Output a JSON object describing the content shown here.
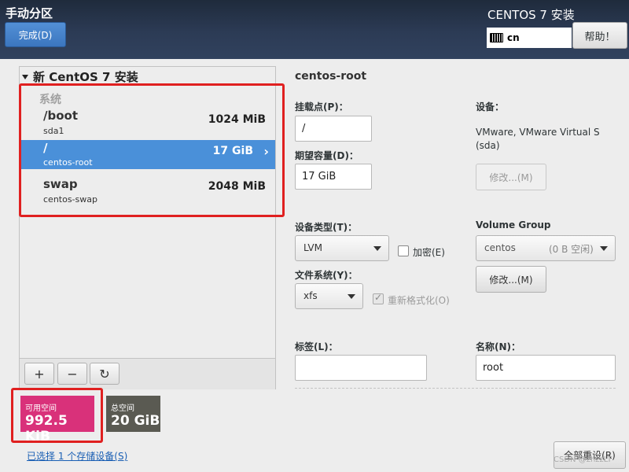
{
  "header": {
    "title": "手动分区",
    "done_label": "完成(D)",
    "install_title": "CENTOS 7 安装",
    "keyboard_layout": "cn",
    "help_label": "帮助！"
  },
  "tree": {
    "root_label": "新 CentOS 7 安装",
    "group_label": "系统",
    "partitions": [
      {
        "mount": "/boot",
        "device": "sda1",
        "size": "1024 MiB",
        "selected": false
      },
      {
        "mount": "/",
        "device": "centos-root",
        "size": "17 GiB",
        "selected": true
      },
      {
        "mount": "swap",
        "device": "centos-swap",
        "size": "2048 MiB",
        "selected": false
      }
    ]
  },
  "toolbar": {
    "add": "+",
    "remove": "−",
    "refresh": "↻"
  },
  "space": {
    "available_label": "可用空间",
    "available_value": "992.5 KiB",
    "available_color": "#d9317a",
    "total_label": "总空间",
    "total_value": "20 GiB",
    "total_color": "#5a5a52"
  },
  "storage_link": "已选择 1 个存储设备(S)",
  "details": {
    "section_title": "centos-root",
    "mount_label": "挂载点(P)：",
    "mount_value": "/",
    "capacity_label": "期望容量(D)：",
    "capacity_value": "17 GiB",
    "device_label": "设备：",
    "device_value": "VMware, VMware Virtual S (sda)",
    "modify_label": "修改...(M)",
    "device_type_label": "设备类型(T)：",
    "device_type_value": "LVM",
    "encrypt_label": "加密(E)",
    "volume_group_label": "Volume Group",
    "volume_group_name": "centos",
    "volume_group_free": "(0 B 空闲)",
    "vg_modify_label": "修改...(M)",
    "fs_label": "文件系统(Y)：",
    "fs_value": "xfs",
    "reformat_label": "重新格式化(O)",
    "tag_label": "标签(L)：",
    "tag_value": "",
    "name_label": "名称(N)：",
    "name_value": "root"
  },
  "reset_label": "全部重设(R)",
  "watermark": "CSDN @zhzzLT",
  "accent": "#e02020"
}
